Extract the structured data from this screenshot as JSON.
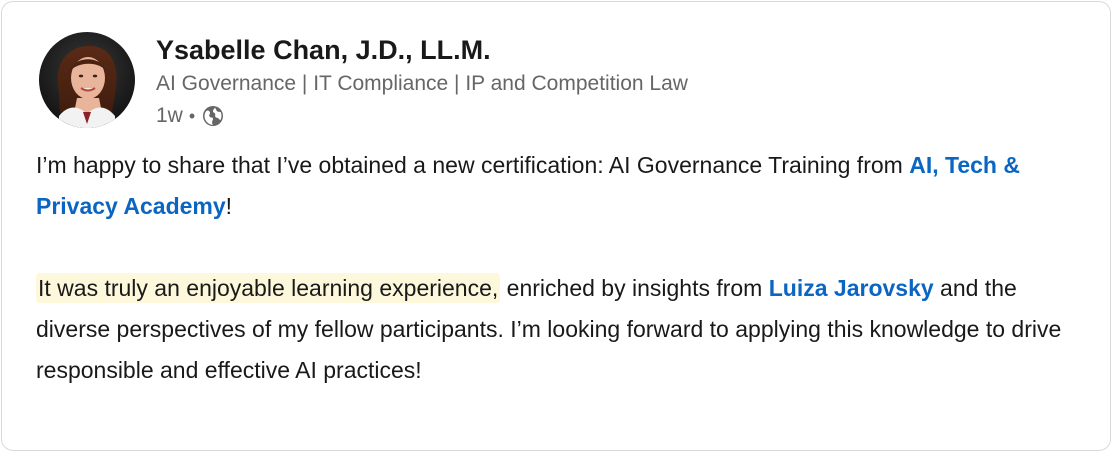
{
  "author": {
    "name": "Ysabelle Chan, J.D., LL.M.",
    "headline": "AI Governance | IT Compliance | IP and Competition Law",
    "time": "1w",
    "separator": "•",
    "visibility_icon": "globe-icon"
  },
  "post": {
    "p1_part1": "I’m happy to share that I’ve obtained a new certification: AI Governance Training from ",
    "p1_link": "AI, Tech & Privacy Academy",
    "p1_end": "!",
    "p2_highlight": "It was truly an enjoyable learning experience,",
    "p2_part1": " enriched by insights from ",
    "p2_link": "Luiza Jarovsky",
    "p2_part2": " and the diverse perspectives of my fellow participants. I’m looking forward to applying this knowledge to drive responsible and effective AI practices!"
  },
  "colors": {
    "link": "#0a66c2",
    "highlight": "#fdf7dc",
    "secondary_text": "#666666",
    "primary_text": "#191919"
  }
}
